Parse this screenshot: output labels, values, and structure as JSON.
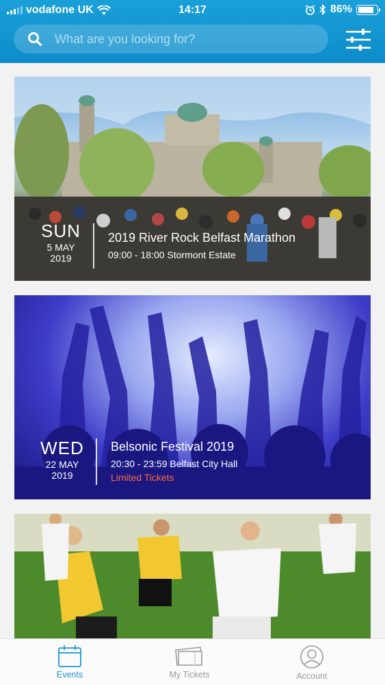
{
  "status_bar": {
    "carrier": "vodafone UK",
    "time": "14:17",
    "battery_percent": "86%",
    "battery_level": 0.86
  },
  "search": {
    "placeholder": "What are you looking for?",
    "icon": "search-icon",
    "filter_icon": "filter-icon"
  },
  "events": [
    {
      "day": "SUN",
      "day_month": "5 MAY",
      "year": "2019",
      "title": "2019 River Rock Belfast Marathon",
      "time_location": "09:00 - 18:00 Stormont Estate",
      "note": ""
    },
    {
      "day": "WED",
      "day_month": "22 MAY",
      "year": "2019",
      "title": "Belsonic Festival 2019",
      "time_location": "20:30 - 23:59 Belfast City Hall",
      "note": "Limited Tickets"
    }
  ],
  "tabs": [
    {
      "label": "Events",
      "icon": "calendar-icon",
      "active": true
    },
    {
      "label": "My Tickets",
      "icon": "ticket-icon",
      "active": false
    },
    {
      "label": "Account",
      "icon": "account-icon",
      "active": false
    }
  ],
  "colors": {
    "header": "#1a9ad6",
    "accent": "#1a96d4",
    "limited": "#ff6a3d"
  }
}
